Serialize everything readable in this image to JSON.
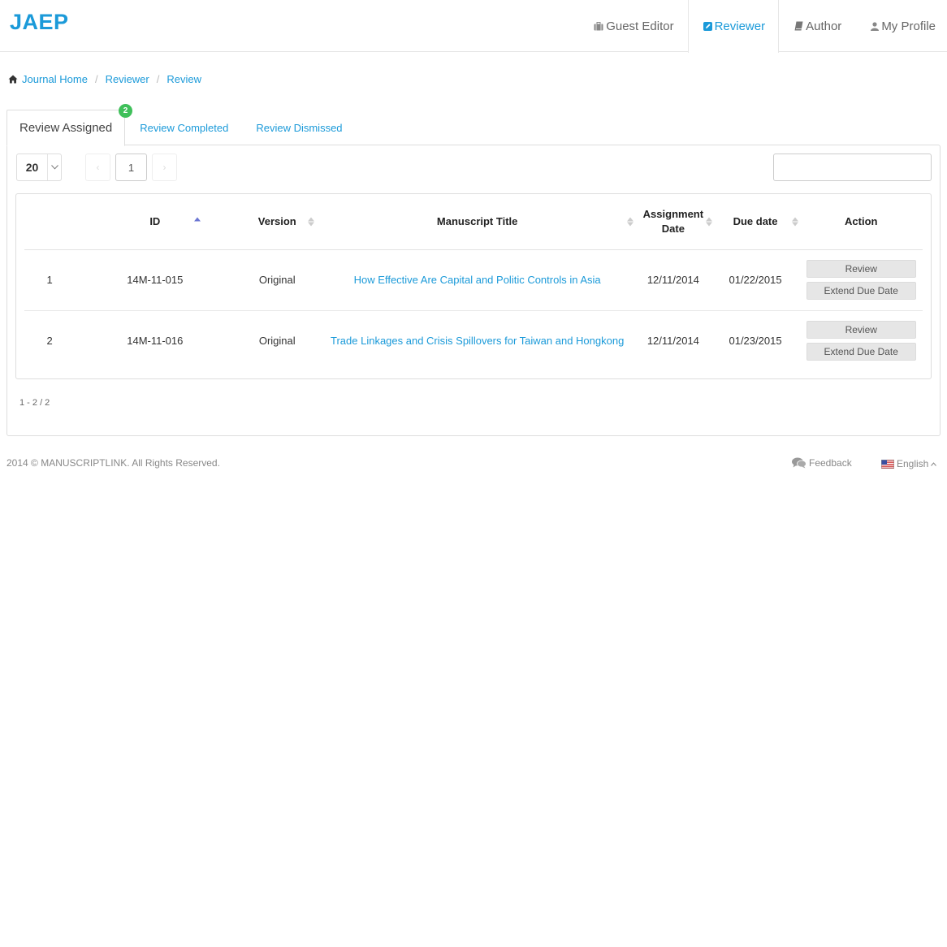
{
  "brand": "JAEP",
  "nav": [
    {
      "label": "Guest Editor",
      "icon": "briefcase-icon"
    },
    {
      "label": "Reviewer",
      "icon": "edit-icon",
      "active": true
    },
    {
      "label": "Author",
      "icon": "book-icon"
    },
    {
      "label": "My Profile",
      "icon": "user-icon"
    }
  ],
  "breadcrumb": [
    "Journal Home",
    "Reviewer",
    "Review"
  ],
  "tabs": [
    {
      "label": "Review Assigned",
      "badge": "2",
      "active": true
    },
    {
      "label": "Review Completed"
    },
    {
      "label": "Review Dismissed"
    }
  ],
  "pager": {
    "page_size": "20",
    "current_page": "1",
    "prev": "‹",
    "next": "›"
  },
  "search": {
    "value": "",
    "placeholder": ""
  },
  "table": {
    "headers": {
      "id": "ID",
      "version": "Version",
      "title": "Manuscript Title",
      "assignment_line1": "Assignment",
      "assignment_line2": "Date",
      "due": "Due date",
      "action": "Action"
    },
    "rows": [
      {
        "num": "1",
        "id": "14M-11-015",
        "version": "Original",
        "title": "How Effective Are Capital and Politic Controls in Asia",
        "assigned": "12/11/2014",
        "due": "01/22/2015",
        "review": "Review",
        "extend": "Extend Due Date"
      },
      {
        "num": "2",
        "id": "14M-11-016",
        "version": "Original",
        "title": "Trade Linkages and Crisis Spillovers for Taiwan and Hongkong",
        "assigned": "12/11/2014",
        "due": "01/23/2015",
        "review": "Review",
        "extend": "Extend Due Date"
      }
    ]
  },
  "record_count": "1 - 2 / 2",
  "footer": {
    "copyright": "2014 © MANUSCRIPTLINK. All Rights Reserved.",
    "feedback": "Feedback",
    "language": "English"
  },
  "colors": {
    "accent": "#1b9ad9",
    "badge": "#3fc05a",
    "sort_active": "#6b76d3"
  }
}
